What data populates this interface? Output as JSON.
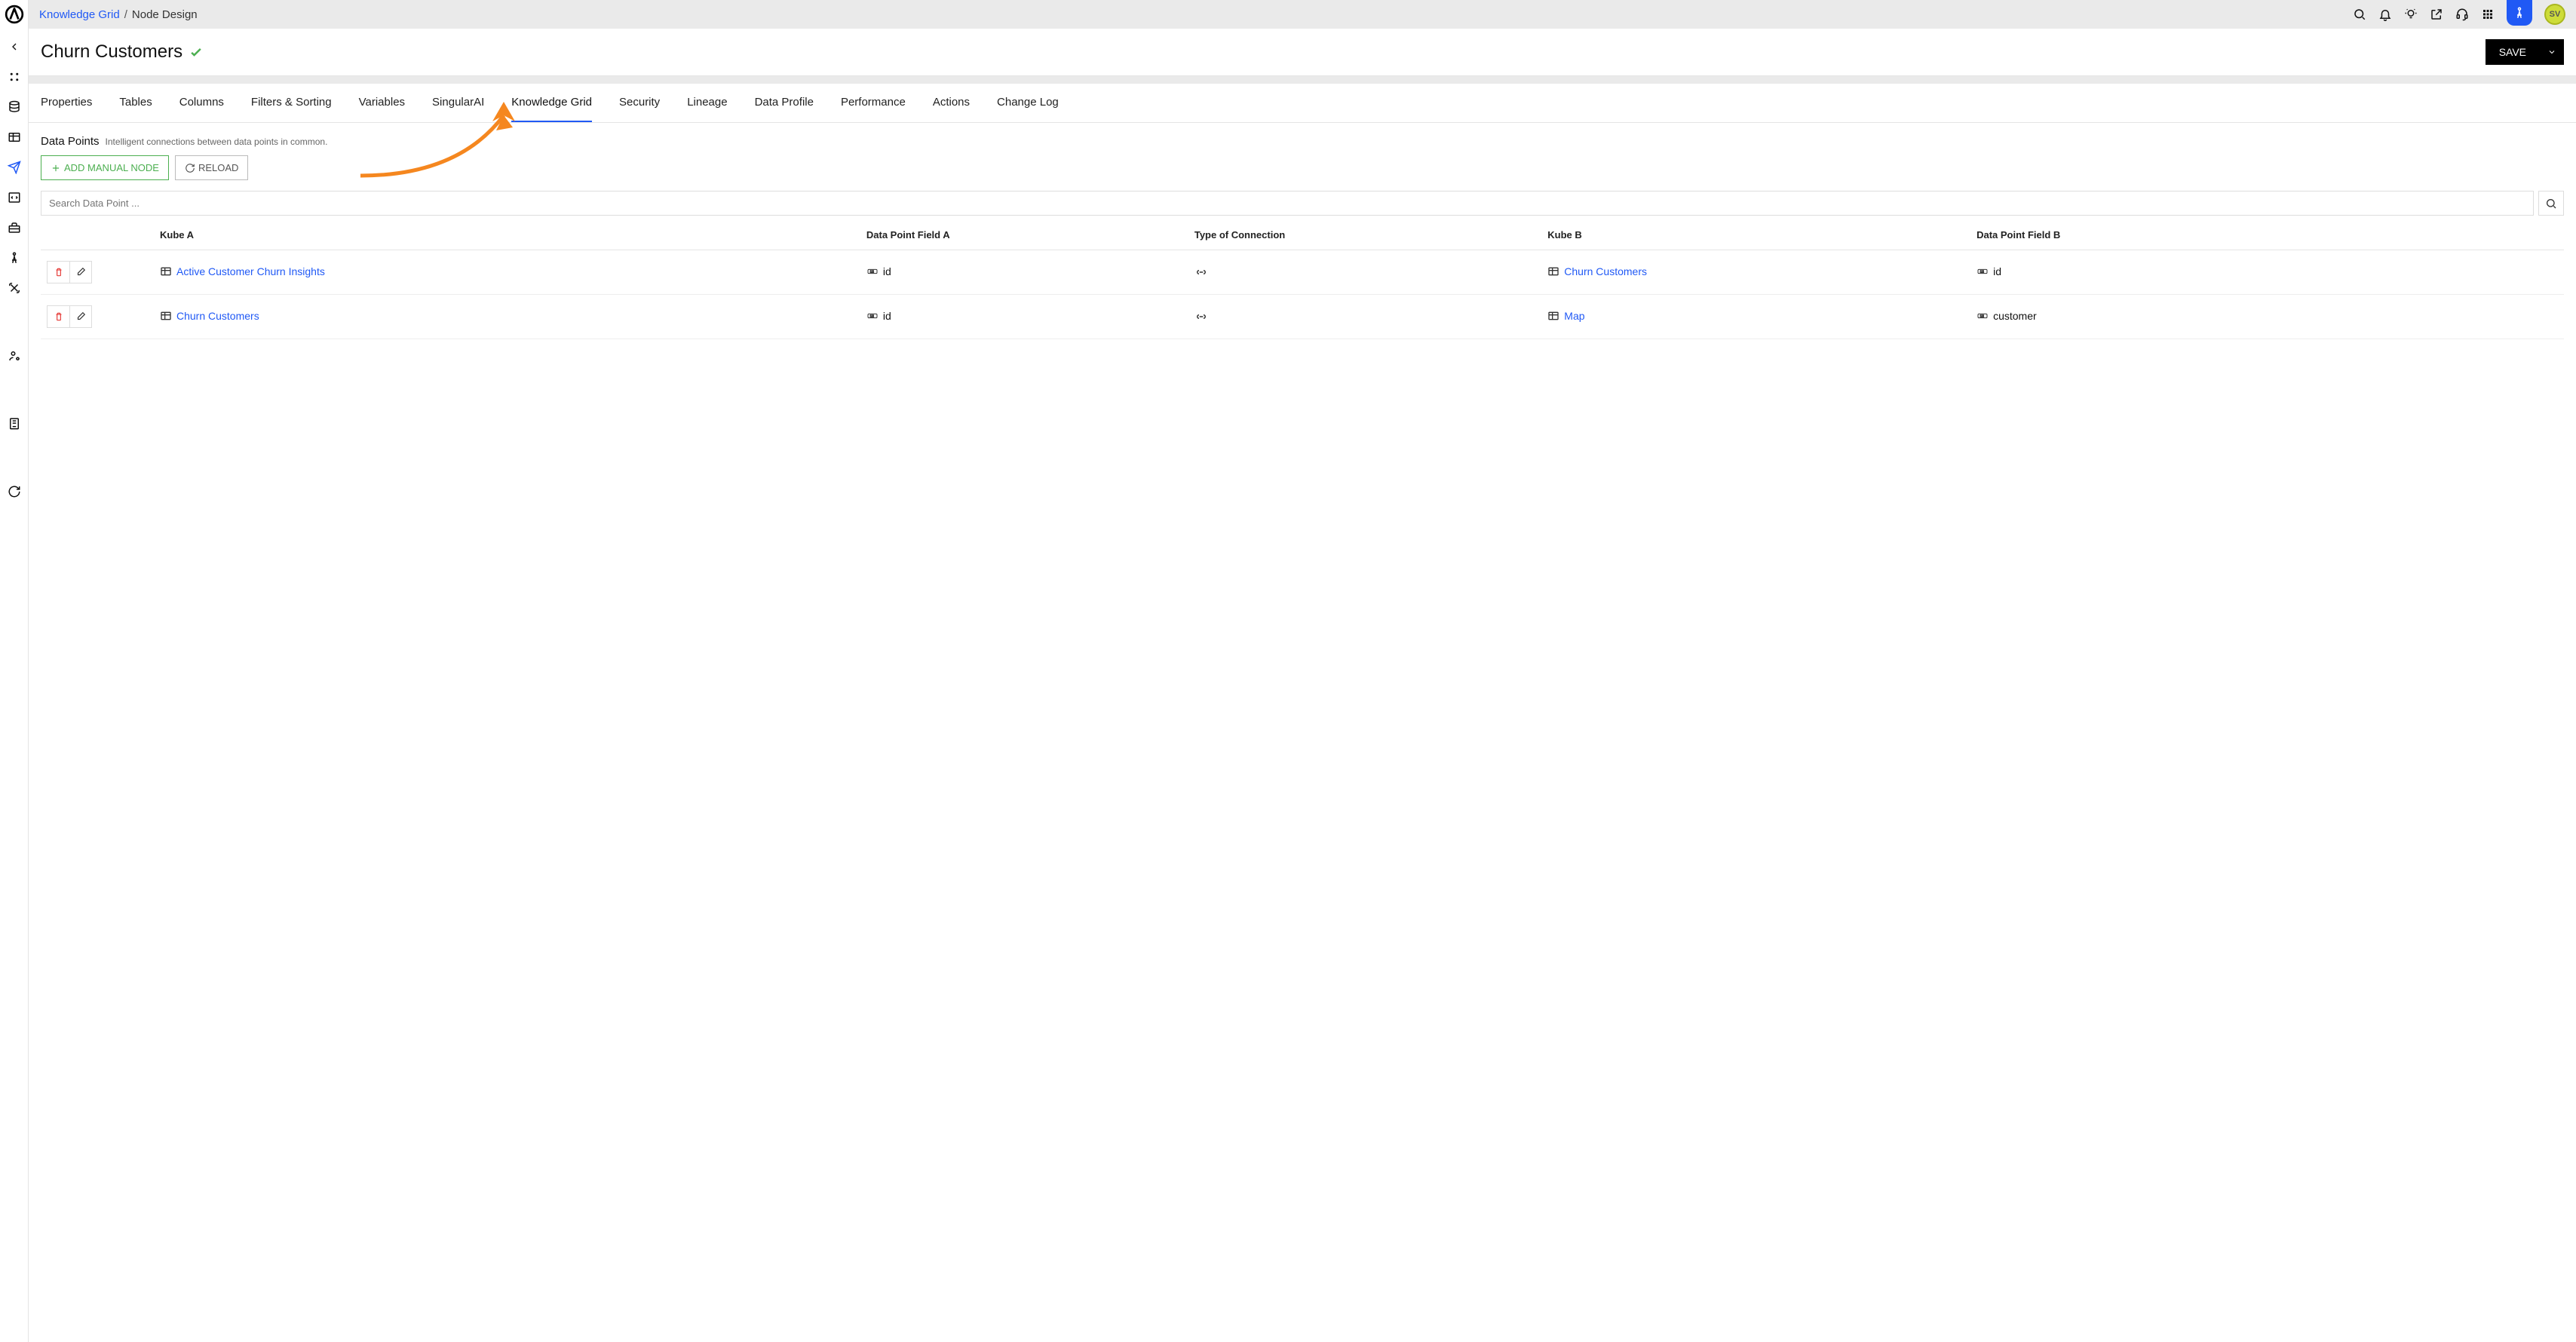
{
  "breadcrumb": {
    "parent": "Knowledge Grid",
    "current": "Node Design"
  },
  "page": {
    "title": "Churn Customers"
  },
  "save": {
    "label": "SAVE"
  },
  "avatar": {
    "initials": "SV"
  },
  "tabs": [
    {
      "label": "Properties"
    },
    {
      "label": "Tables"
    },
    {
      "label": "Columns"
    },
    {
      "label": "Filters & Sorting"
    },
    {
      "label": "Variables"
    },
    {
      "label": "SingularAI"
    },
    {
      "label": "Knowledge Grid",
      "active": true
    },
    {
      "label": "Security"
    },
    {
      "label": "Lineage"
    },
    {
      "label": "Data Profile"
    },
    {
      "label": "Performance"
    },
    {
      "label": "Actions"
    },
    {
      "label": "Change Log"
    }
  ],
  "section": {
    "title": "Data Points",
    "subtitle": "Intelligent connections between data points in common."
  },
  "buttons": {
    "addManual": "ADD MANUAL NODE",
    "reload": "RELOAD"
  },
  "search": {
    "placeholder": "Search Data Point ..."
  },
  "table": {
    "headers": {
      "kubeA": "Kube A",
      "fieldA": "Data Point Field A",
      "conn": "Type of Connection",
      "kubeB": "Kube B",
      "fieldB": "Data Point Field B"
    },
    "rows": [
      {
        "kubeA": "Active Customer Churn Insights",
        "fieldA": "id",
        "kubeB": "Churn Customers",
        "fieldB": "id"
      },
      {
        "kubeA": "Churn Customers",
        "fieldA": "id",
        "kubeB": "Map",
        "fieldB": "customer"
      }
    ]
  }
}
